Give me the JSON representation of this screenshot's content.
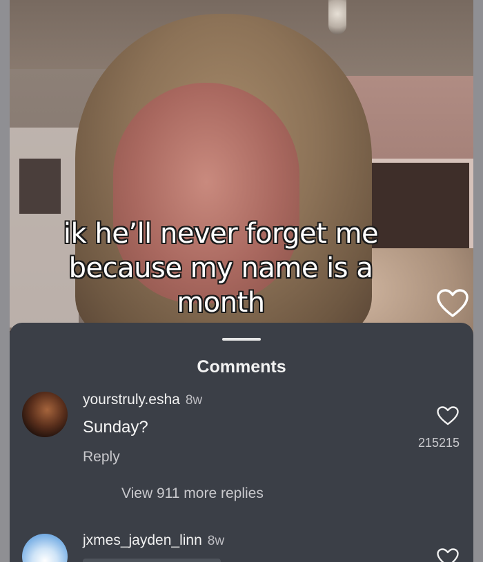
{
  "video": {
    "caption_lines": [
      "ik he’ll never forget me",
      "because my name is a",
      "month"
    ]
  },
  "comments_sheet": {
    "title": "Comments",
    "comments": [
      {
        "username": "yourstruly.esha",
        "time": "8w",
        "text": "Sunday?",
        "reply_label": "Reply",
        "like_count": "215215",
        "view_replies": "View 911 more replies"
      },
      {
        "username": "jxmes_jayden_linn",
        "time": "8w"
      }
    ]
  },
  "colors": {
    "sheet_background": "#3b3f47",
    "frame_background": "#8f8f93",
    "text_primary": "#f5f5f5",
    "text_secondary": "#c9c9cd"
  },
  "icons": [
    "heart-outline-icon"
  ]
}
